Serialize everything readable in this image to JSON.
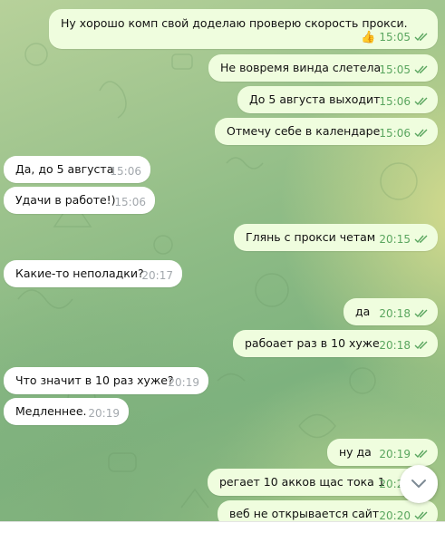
{
  "messages": [
    {
      "text": "Ну хорошо комп свой доделаю проверю скорость прокси.",
      "time": "15:05",
      "reaction": "👍"
    },
    {
      "text": "Не вовремя винда слетела",
      "time": "15:05"
    },
    {
      "text": "До 5 августа выходит",
      "time": "15:06"
    },
    {
      "text": "Отмечу себе в календаре",
      "time": "15:06"
    },
    {
      "text": "Да, до 5 августа",
      "time": "15:06"
    },
    {
      "text": "Удачи в работе!)",
      "time": "15:06"
    },
    {
      "text": "Глянь с прокси четам",
      "time": "20:15"
    },
    {
      "text": "Какие-то неполадки?",
      "time": "20:17"
    },
    {
      "text": "да",
      "time": "20:18"
    },
    {
      "text": "рабоает раз в 10 хуже",
      "time": "20:18"
    },
    {
      "text": "Что значит в 10 раз хуже?",
      "time": "20:19"
    },
    {
      "text": "Медленнее.",
      "time": "20:19"
    },
    {
      "text": "ну да",
      "time": "20:19"
    },
    {
      "text": "регает 10 акков щас тока 1",
      "time": "20:20"
    },
    {
      "text": "веб не открывается сайт",
      "time": "20:20"
    }
  ],
  "colors": {
    "outgoing_bubble": "#effdde",
    "incoming_bubble": "#ffffff",
    "read_check": "#5aa65f",
    "incoming_time": "#a3a8ad"
  },
  "icons": {
    "reaction": "thumbs-up-icon",
    "status": "double-check-icon",
    "scroll": "chevron-down-icon"
  }
}
